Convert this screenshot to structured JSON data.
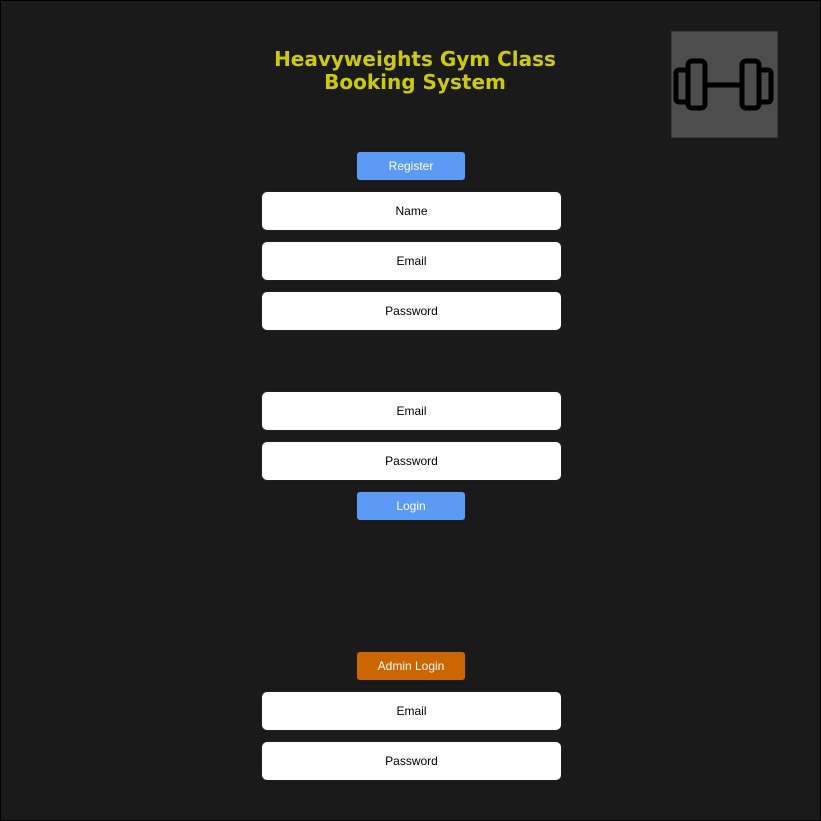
{
  "header": {
    "title_line1": "Heavyweights Gym Class",
    "title_line2": "Booking System",
    "logo_icon": "dumbbell-icon"
  },
  "register": {
    "button_label": "Register",
    "name_placeholder": "Name",
    "email_placeholder": "Email",
    "password_placeholder": "Password"
  },
  "login": {
    "email_placeholder": "Email",
    "password_placeholder": "Password",
    "button_label": "Login"
  },
  "admin_login": {
    "button_label": "Admin Login",
    "email_placeholder": "Email",
    "password_placeholder": "Password"
  },
  "colors": {
    "background": "#1a1a1a",
    "title": "#cccc00",
    "primary_button": "#5b9bf5",
    "admin_button": "#cc6600",
    "logo_background": "#4d4d4d"
  }
}
